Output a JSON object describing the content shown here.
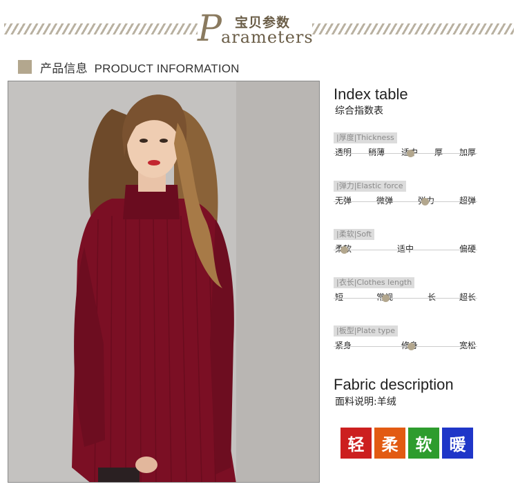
{
  "header": {
    "title_cn": "宝贝参数",
    "title_en_initial": "P",
    "title_en_rest": "arameters"
  },
  "section": {
    "title": "产品信息  PRODUCT INFORMATION"
  },
  "index_table": {
    "title_en": "Index table",
    "title_cn": "综合指数表",
    "params": [
      {
        "label": "|厚度|Thickness",
        "options": [
          "透明",
          "稍薄",
          "适中",
          "厚",
          "加厚"
        ],
        "selected_index": 2
      },
      {
        "label": "|弹力|Elastic force",
        "options": [
          "无弹",
          "微弹",
          "弹力",
          "超弹"
        ],
        "selected_index": 2
      },
      {
        "label": "|柔软|Soft",
        "options": [
          "柔软",
          "适中",
          "偏硬"
        ],
        "selected_index": 0
      },
      {
        "label": "|衣长|Clothes length",
        "options": [
          "短",
          "常规",
          "长",
          "超长"
        ],
        "selected_index": 1
      },
      {
        "label": "|板型|Plate type",
        "options": [
          "紧身",
          "修身",
          "宽松"
        ],
        "selected_index": 1
      }
    ]
  },
  "fabric": {
    "title_en": "Fabric description",
    "title_cn": "面料说明:羊绒",
    "badges": [
      {
        "text": "轻",
        "color": "#cc1f1f"
      },
      {
        "text": "柔",
        "color": "#e25a12"
      },
      {
        "text": "软",
        "color": "#2e9c2e"
      },
      {
        "text": "暖",
        "color": "#1f36c8"
      }
    ]
  },
  "colors": {
    "accent": "#b3a78e",
    "sweater": "#7b0f24"
  }
}
